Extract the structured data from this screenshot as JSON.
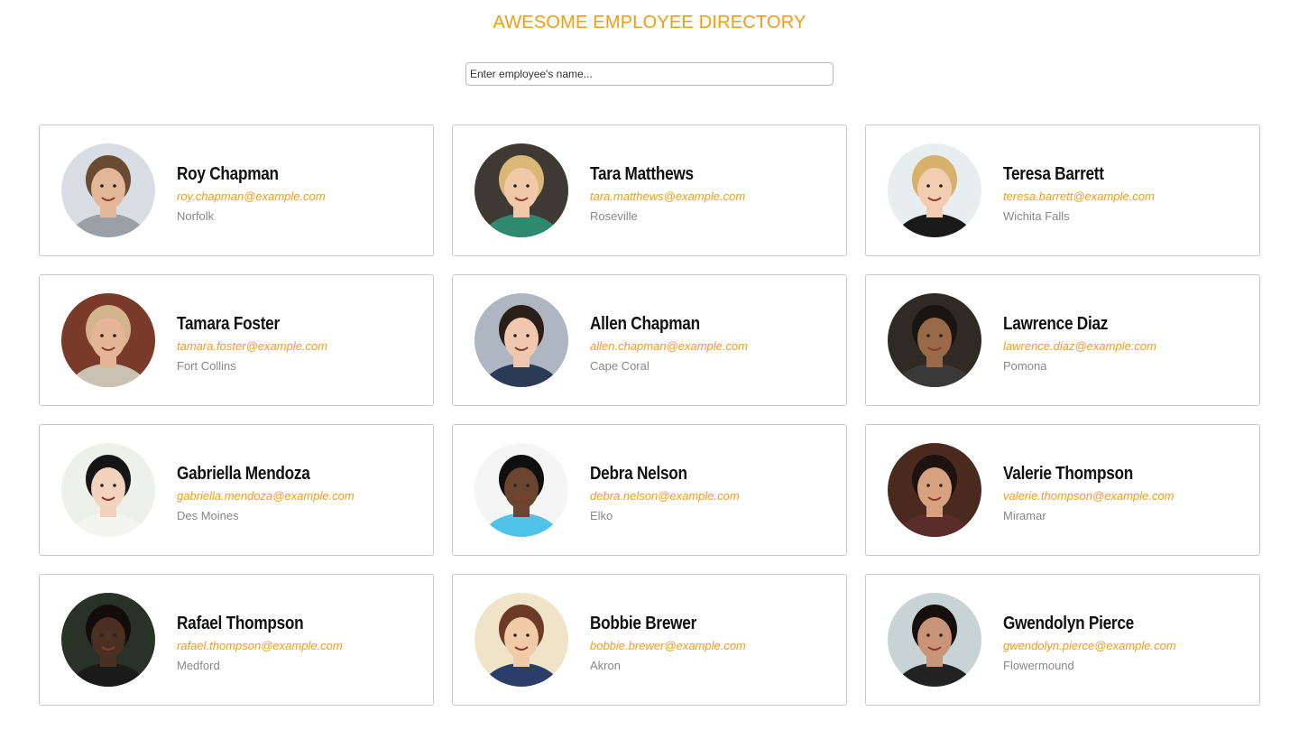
{
  "header": {
    "title": "AWESOME EMPLOYEE DIRECTORY"
  },
  "search": {
    "placeholder": "Enter employee's name...",
    "value": ""
  },
  "colors": {
    "accent": "#f39c12",
    "text": "#111111",
    "muted": "#888888",
    "border": "#c8c8c8"
  },
  "employees": [
    {
      "name": "Roy Chapman",
      "email": "roy.chapman@example.com",
      "city": "Norfolk",
      "bg": "#d7dde2",
      "skin": "#e3b89a",
      "hair": "#6b4a32",
      "shirt": "#9aa0a6"
    },
    {
      "name": "Tara Matthews",
      "email": "tara.matthews@example.com",
      "city": "Roseville",
      "bg": "#3e3a33",
      "skin": "#f0c9a8",
      "hair": "#d9b877",
      "shirt": "#2e8a6e"
    },
    {
      "name": "Teresa Barrett",
      "email": "teresa.barrett@example.com",
      "city": "Wichita Falls",
      "bg": "#e8edf0",
      "skin": "#f2cdb2",
      "hair": "#d7b06c",
      "shirt": "#1a1a1a"
    },
    {
      "name": "Tamara Foster",
      "email": "tamara.foster@example.com",
      "city": "Fort Collins",
      "bg": "#7a3a2a",
      "skin": "#e6b597",
      "hair": "#d4b48c",
      "shirt": "#c9c2b2"
    },
    {
      "name": "Allen Chapman",
      "email": "allen.chapman@example.com",
      "city": "Cape Coral",
      "bg": "#aeb6c2",
      "skin": "#f0c8b0",
      "hair": "#2a1e18",
      "shirt": "#2b3a55"
    },
    {
      "name": "Lawrence Diaz",
      "email": "lawrence.diaz@example.com",
      "city": "Pomona",
      "bg": "#2f2a24",
      "skin": "#9a6a48",
      "hair": "#1b1510",
      "shirt": "#3a3a3a"
    },
    {
      "name": "Gabriella Mendoza",
      "email": "gabriella.mendoza@example.com",
      "city": "Des Moines",
      "bg": "#eef0ea",
      "skin": "#f3d3bd",
      "hair": "#151515",
      "shirt": "#f4f4f0"
    },
    {
      "name": "Debra Nelson",
      "email": "debra.nelson@example.com",
      "city": "Elko",
      "bg": "#f5f5f5",
      "skin": "#6b4430",
      "hair": "#0f0f0f",
      "shirt": "#4fc3e8"
    },
    {
      "name": "Valerie Thompson",
      "email": "valerie.thompson@example.com",
      "city": "Miramar",
      "bg": "#4a2a1f",
      "skin": "#d9a27e",
      "hair": "#1d120d",
      "shirt": "#5a2c2c"
    },
    {
      "name": "Rafael Thompson",
      "email": "rafael.thompson@example.com",
      "city": "Medford",
      "bg": "#283226",
      "skin": "#4a2f22",
      "hair": "#120d0a",
      "shirt": "#1a1a1a"
    },
    {
      "name": "Bobbie Brewer",
      "email": "bobbie.brewer@example.com",
      "city": "Akron",
      "bg": "#f0e4c8",
      "skin": "#f1caa8",
      "hair": "#6d3b25",
      "shirt": "#2a3d6b"
    },
    {
      "name": "Gwendolyn Pierce",
      "email": "gwendolyn.pierce@example.com",
      "city": "Flowermound",
      "bg": "#c8d3d6",
      "skin": "#c99478",
      "hair": "#15100d",
      "shirt": "#222222"
    }
  ]
}
